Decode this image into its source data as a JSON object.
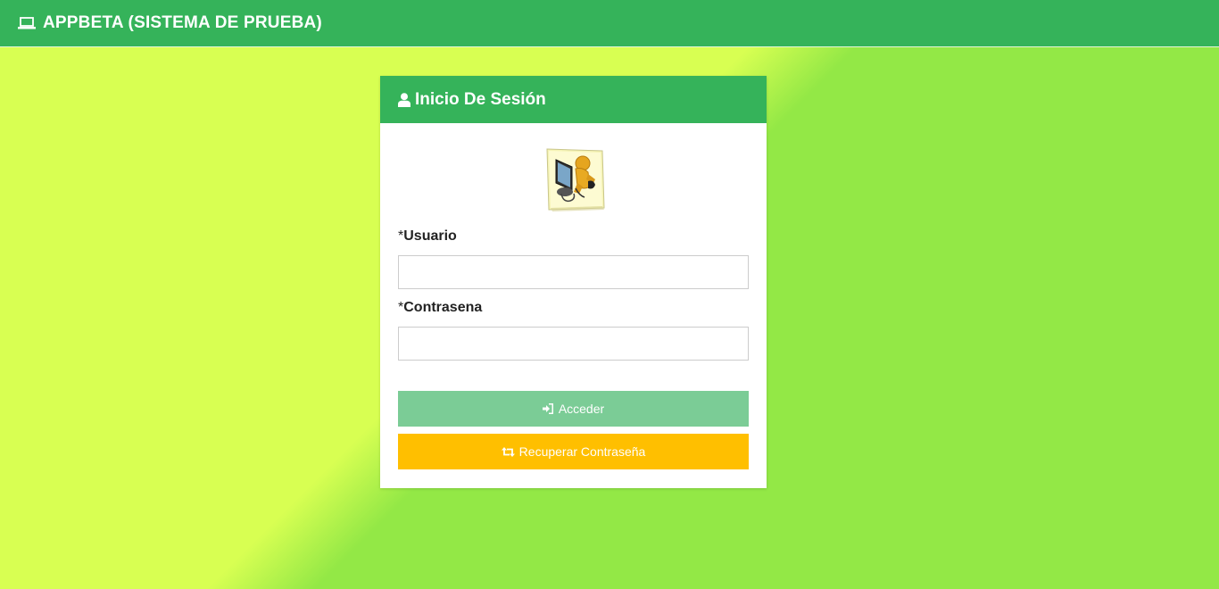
{
  "navbar": {
    "icon": "laptop-icon",
    "title": "APPBETA (SISTEMA DE PRUEBA)"
  },
  "login_card": {
    "header_icon": "user-icon",
    "title": "Inicio De Sesión",
    "logo": "person-at-computer-logo",
    "user_field": {
      "required_mark": "*",
      "label": "Usuario",
      "value": "",
      "placeholder": ""
    },
    "password_field": {
      "required_mark": "*",
      "label": "Contrasena",
      "value": "",
      "placeholder": ""
    },
    "login_button": {
      "icon": "sign-in-icon",
      "label": "Acceder"
    },
    "recover_button": {
      "icon": "retweet-icon",
      "label": "Recuperar Contraseña"
    }
  },
  "colors": {
    "primary_green": "#35b35a",
    "background_light": "#d8ff52",
    "background_dark": "#93e846",
    "login_button": "#7bcc96",
    "recover_button": "#ffbf00"
  }
}
